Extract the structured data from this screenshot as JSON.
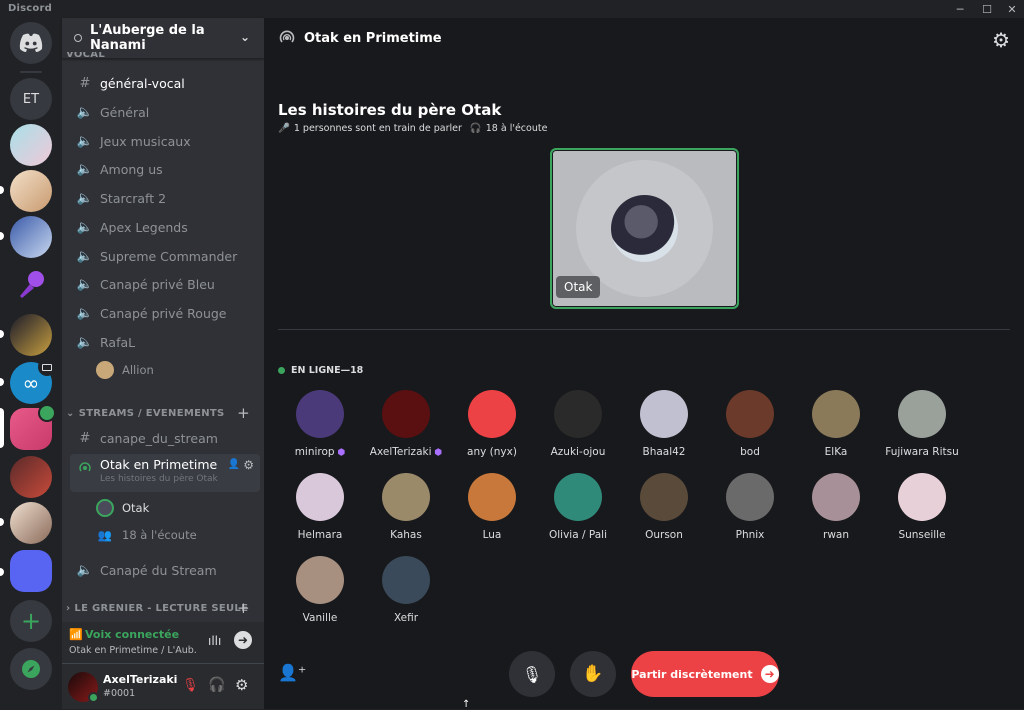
{
  "window": {
    "app_title": "Discord",
    "minimize": "─",
    "maximize": "☐",
    "close": "✕"
  },
  "rail": {
    "home_icon": "discord-logo-icon",
    "et_label": "ET",
    "add_icon": "+",
    "explore_icon": "compass-icon"
  },
  "sidebar": {
    "server_name": "L'Auberge de la Nanami",
    "voice_category_cut": "VOCAL",
    "channels": [
      {
        "label": "général-vocal",
        "type": "text"
      },
      {
        "label": "Général",
        "type": "voice"
      },
      {
        "label": "Jeux musicaux",
        "type": "voice"
      },
      {
        "label": "Among us",
        "type": "voice"
      },
      {
        "label": "Starcraft 2",
        "type": "voice"
      },
      {
        "label": "Apex Legends",
        "type": "voice"
      },
      {
        "label": "Supreme Commander",
        "type": "voice"
      },
      {
        "label": "Canapé privé Bleu",
        "type": "voice"
      },
      {
        "label": "Canapé privé Rouge",
        "type": "voice"
      },
      {
        "label": "RafaL",
        "type": "voice"
      }
    ],
    "rafal_member": "Allion",
    "streams_category": "STREAMS / EVENEMENTS",
    "canape_stream": "canape_du_stream",
    "stage_channel": {
      "label": "Otak en Primetime",
      "topic": "Les histoires du père Otak"
    },
    "stage_speaker": "Otak",
    "stage_listeners": "18 à l'écoute",
    "canape_du_stream": "Canapé du Stream",
    "grenier_category": "LE GRENIER - LECTURE SEULE"
  },
  "voice_panel": {
    "status": "Voix connectée",
    "location": "Otak en Primetime / L'Aub..."
  },
  "user_panel": {
    "name": "AxelTerizaki",
    "tag": "#0001"
  },
  "stage": {
    "header_title": "Otak en Primetime",
    "title": "Les histoires du père Otak",
    "speaking": "1 personnes sont en train de parler",
    "listening": "18 à l'écoute",
    "speaker_name": "Otak",
    "online_label": "EN LIGNE—18",
    "audience": [
      {
        "name": "minirop",
        "color": "#4b3a7a",
        "badge": true
      },
      {
        "name": "AxelTerizaki",
        "color": "#5a1010",
        "badge": true
      },
      {
        "name": "any (nyx)",
        "color": "#ed4245",
        "badge": false
      },
      {
        "name": "Azuki-ojou",
        "color": "#2a2a2a",
        "badge": false
      },
      {
        "name": "Bhaal42",
        "color": "#c0c0d0",
        "badge": false
      },
      {
        "name": "bod",
        "color": "#6b3a2a",
        "badge": false
      },
      {
        "name": "ElKa",
        "color": "#8a7a5a",
        "badge": false
      },
      {
        "name": "Fujiwara Ritsu",
        "color": "#9aa09a",
        "badge": false
      },
      {
        "name": "Helmara",
        "color": "#d9c8d9",
        "badge": false
      },
      {
        "name": "Kahas",
        "color": "#9a8a6a",
        "badge": false
      },
      {
        "name": "Lua",
        "color": "#c8783a",
        "badge": false
      },
      {
        "name": "Olivia / Pali",
        "color": "#2f8a7a",
        "badge": false
      },
      {
        "name": "Ourson",
        "color": "#5a4a3a",
        "badge": false
      },
      {
        "name": "Phnix",
        "color": "#6a6a6a",
        "badge": false
      },
      {
        "name": "rwan",
        "color": "#a89098",
        "badge": false
      },
      {
        "name": "Sunseille",
        "color": "#e8d0d8",
        "badge": false
      },
      {
        "name": "Vanille",
        "color": "#a89080",
        "badge": false
      },
      {
        "name": "Xefir",
        "color": "#3a4a5a",
        "badge": false
      }
    ],
    "leave_button": "Partir discrètement"
  },
  "colors": {
    "accent_green": "#3ba55d",
    "danger": "#ed4245",
    "brand": "#5865f2"
  }
}
